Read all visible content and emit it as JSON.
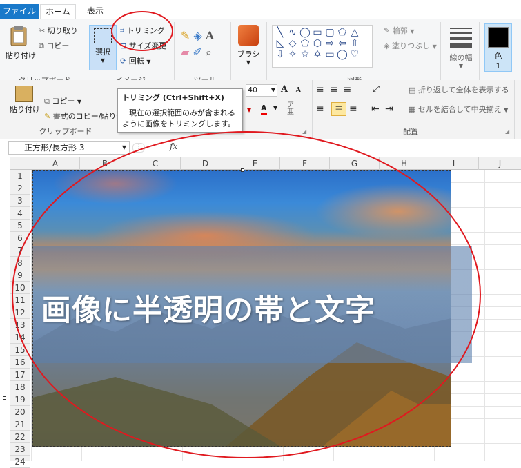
{
  "paint": {
    "tabs": {
      "file": "ファイル",
      "home": "ホーム",
      "view": "表示"
    },
    "clipboard": {
      "paste": "貼り付け",
      "cut": "切り取り",
      "copy": "コピー",
      "group": "クリップボード"
    },
    "image": {
      "select": "選択",
      "crop": "トリミング",
      "resize": "サイズ変更",
      "rotate": "回転",
      "group": "イメージ"
    },
    "tools": {
      "group": "ツール"
    },
    "brush": {
      "label": "ブラシ"
    },
    "shapes": {
      "outline": "輪郭",
      "fill": "塗りつぶし",
      "group": "図形"
    },
    "size": {
      "label": "線の幅"
    },
    "color": {
      "label": "色",
      "sub": "1"
    }
  },
  "excel": {
    "clipboard": {
      "paste": "貼り付け",
      "copy": "コピー",
      "format_copy": "書式のコピー/貼り付け",
      "group": "クリップボード"
    },
    "font_size": "40",
    "align": {
      "wrap": "折り返して全体を表示する",
      "merge": "セルを結合して中央揃え",
      "group": "配置"
    },
    "name_box": "正方形/長方形 3",
    "fx": "fx",
    "columns": [
      "A",
      "B",
      "C",
      "D",
      "E",
      "F",
      "G",
      "H",
      "I",
      "J"
    ],
    "rows": [
      "1",
      "2",
      "3",
      "4",
      "5",
      "6",
      "7",
      "8",
      "9",
      "10",
      "11",
      "12",
      "13",
      "14",
      "15",
      "16",
      "17",
      "18",
      "19",
      "20",
      "21",
      "22",
      "23",
      "24"
    ]
  },
  "tooltip": {
    "title": "トリミング (Ctrl+Shift+X)",
    "line1": "現在の選択範囲のみが含まれる",
    "line2": "ように画像をトリミングします。"
  },
  "overlay_text": "画像に半透明の帯と文字",
  "annotation_color": "#e0191f"
}
